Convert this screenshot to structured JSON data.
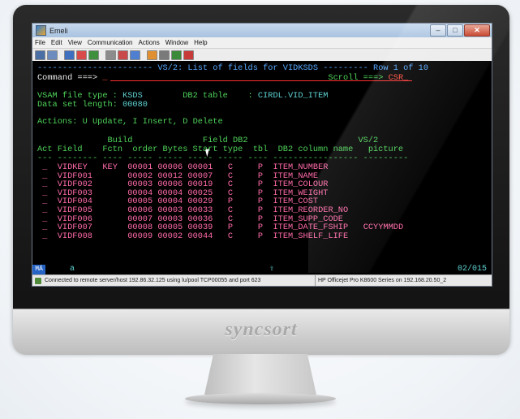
{
  "window": {
    "title": "Emeli",
    "controls": [
      "–",
      "□",
      "✕"
    ]
  },
  "menu": [
    "File",
    "Edit",
    "View",
    "Communication",
    "Actions",
    "Window",
    "Help"
  ],
  "toolbar": {
    "icon_colors": [
      "#4a6fa5",
      "#6c8cc0",
      "#3f6fbf",
      "#d94b4b",
      "#3e8f3e",
      "#8c8c8c",
      "#c94a4a",
      "#4f7fd0",
      "#e09030",
      "#7a7a7a",
      "#3a8a3a",
      "#c83a3a"
    ]
  },
  "terminal": {
    "header_dashes_left": "-----------------------",
    "header_title": "VS/2: List of fields for VIDKSDS",
    "header_dashes_right": "---------",
    "row_indicator": "Row 1 of 10",
    "command_label": "Command ===>",
    "command_value": "_",
    "scroll_label": "Scroll ===>",
    "scroll_value": "CSR_",
    "vsam_label": "VSAM file type :",
    "vsam_value": "KSDS",
    "db2_label": "DB2 table    :",
    "db2_value": "CIRDL.VID_ITEM",
    "dsl_label": "Data set length:",
    "dsl_value": "00080",
    "actions_label": "Actions:",
    "actions_text": "U Update, I Insert, D Delete",
    "col_head_1": "              Build              Field DB2                      VS/2",
    "col_head_2": "Act Field    Fctn  order Bytes Start type  tbl  DB2 column name   picture",
    "col_rule": "--- -------- ---- ----- ----- ----- ----- ---- ----------------- ---------",
    "rows": [
      {
        "act": "_",
        "field": "VIDKEY",
        "fctn": "KEY",
        "order": "00001",
        "bytes": "00006",
        "start": "00001",
        "type": "C",
        "tbl": "P",
        "col": "ITEM_NUMBER",
        "pic": ""
      },
      {
        "act": "_",
        "field": "VIDF001",
        "fctn": "",
        "order": "00002",
        "bytes": "00012",
        "start": "00007",
        "type": "C",
        "tbl": "P",
        "col": "ITEM_NAME",
        "pic": ""
      },
      {
        "act": "_",
        "field": "VIDF002",
        "fctn": "",
        "order": "00003",
        "bytes": "00006",
        "start": "00019",
        "type": "C",
        "tbl": "P",
        "col": "ITEM_COLOUR",
        "pic": ""
      },
      {
        "act": "_",
        "field": "VIDF003",
        "fctn": "",
        "order": "00004",
        "bytes": "00004",
        "start": "00025",
        "type": "C",
        "tbl": "P",
        "col": "ITEM_WEIGHT",
        "pic": ""
      },
      {
        "act": "_",
        "field": "VIDF004",
        "fctn": "",
        "order": "00005",
        "bytes": "00004",
        "start": "00029",
        "type": "P",
        "tbl": "P",
        "col": "ITEM_COST",
        "pic": ""
      },
      {
        "act": "_",
        "field": "VIDF005",
        "fctn": "",
        "order": "00006",
        "bytes": "00003",
        "start": "00033",
        "type": "C",
        "tbl": "P",
        "col": "ITEM_REORDER_NO",
        "pic": ""
      },
      {
        "act": "_",
        "field": "VIDF006",
        "fctn": "",
        "order": "00007",
        "bytes": "00003",
        "start": "00036",
        "type": "C",
        "tbl": "P",
        "col": "ITEM_SUPP_CODE",
        "pic": ""
      },
      {
        "act": "_",
        "field": "VIDF007",
        "fctn": "",
        "order": "00008",
        "bytes": "00005",
        "start": "00039",
        "type": "P",
        "tbl": "P",
        "col": "ITEM_DATE_FSHIP",
        "pic": "CCYYMMDD"
      },
      {
        "act": "_",
        "field": "VIDF008",
        "fctn": "",
        "order": "00009",
        "bytes": "00002",
        "start": "00044",
        "type": "C",
        "tbl": "P",
        "col": "ITEM_SHELF_LIFE",
        "pic": ""
      }
    ]
  },
  "oia": {
    "session": "MÁ",
    "indicator": "a",
    "lock": "⇧",
    "position": "02/015"
  },
  "statusbar": {
    "connection": "Connected to remote server/host 192.86.32.125 using lu/pool TCP00055 and port 623",
    "printer": "HP Officejet Pro K8600 Series on 192.168.20.50_2"
  },
  "brand": "syncsort",
  "colors": {
    "terminal_bg": "#000000",
    "blue_text": "#56a8ff",
    "green_text": "#4fd35a",
    "turquoise_text": "#5fd2d2",
    "pink_text": "#ff6aa8",
    "red_text": "#ff4a3a"
  }
}
